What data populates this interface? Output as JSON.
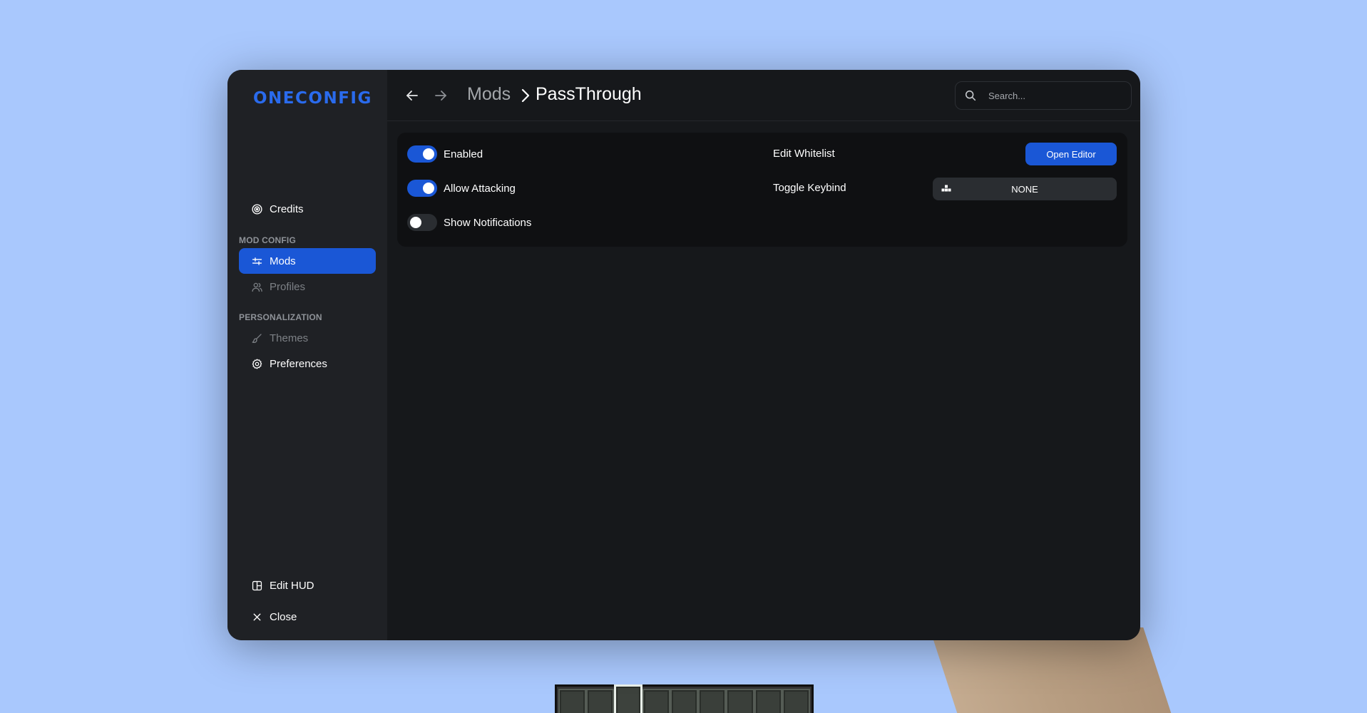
{
  "app": {
    "logo": "ONECONFIG"
  },
  "sidebar": {
    "top_items": [
      {
        "label": "Credits",
        "icon": "credits-icon",
        "state": "normal"
      }
    ],
    "sections": [
      {
        "title": "MOD CONFIG",
        "items": [
          {
            "label": "Mods",
            "icon": "sliders-icon",
            "state": "active"
          },
          {
            "label": "Profiles",
            "icon": "users-icon",
            "state": "disabled"
          }
        ]
      },
      {
        "title": "PERSONALIZATION",
        "items": [
          {
            "label": "Themes",
            "icon": "brush-icon",
            "state": "disabled"
          },
          {
            "label": "Preferences",
            "icon": "gear-icon",
            "state": "normal"
          }
        ]
      }
    ],
    "bottom_items": [
      {
        "label": "Edit HUD",
        "icon": "layout-icon"
      },
      {
        "label": "Close",
        "icon": "close-icon"
      }
    ]
  },
  "header": {
    "breadcrumb_parent": "Mods",
    "breadcrumb_current": "PassThrough",
    "search_placeholder": "Search..."
  },
  "options": {
    "enabled": {
      "label": "Enabled",
      "on": true
    },
    "allow_attacking": {
      "label": "Allow Attacking",
      "on": true
    },
    "show_notifications": {
      "label": "Show Notifications",
      "on": false
    },
    "edit_whitelist": {
      "label": "Edit Whitelist",
      "button": "Open Editor"
    },
    "toggle_keybind": {
      "label": "Toggle Keybind",
      "value": "NONE"
    }
  },
  "colors": {
    "accent": "#1a57d6",
    "logo": "#2a6bed",
    "background": "#a9c8fd",
    "sidebar": "#1f2125",
    "main": "#16181b",
    "card": "#0f1012"
  }
}
